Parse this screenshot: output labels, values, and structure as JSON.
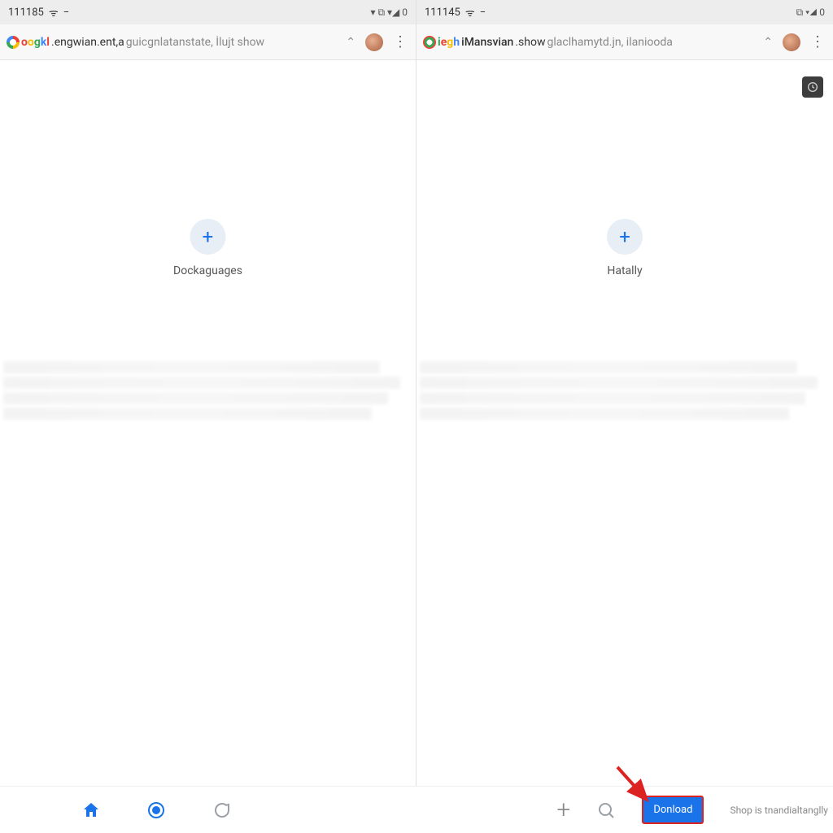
{
  "left": {
    "status": {
      "time": "111185",
      "icons": "▾ ⧉ ▾◢ 0"
    },
    "url": {
      "hostPrefix": "oogkl",
      "hostRest": ".engwian.ent,a",
      "path": " guicgnlatanstate, İlujt  show"
    },
    "shortcut": {
      "label": "Dockaguages"
    }
  },
  "right": {
    "status": {
      "time": "111145",
      "icons": "⧉ ▾◢ 0"
    },
    "url": {
      "hostPrefix": "iegh",
      "hostMid": "iMansvian",
      "hostSuffix": ".show",
      "path": " glaclhamytd.jn, ilaniooda"
    },
    "shortcut": {
      "label": "Hatally"
    }
  },
  "bottom": {
    "donload": "Donload",
    "footer": "Shop is tnandialtanglly"
  }
}
